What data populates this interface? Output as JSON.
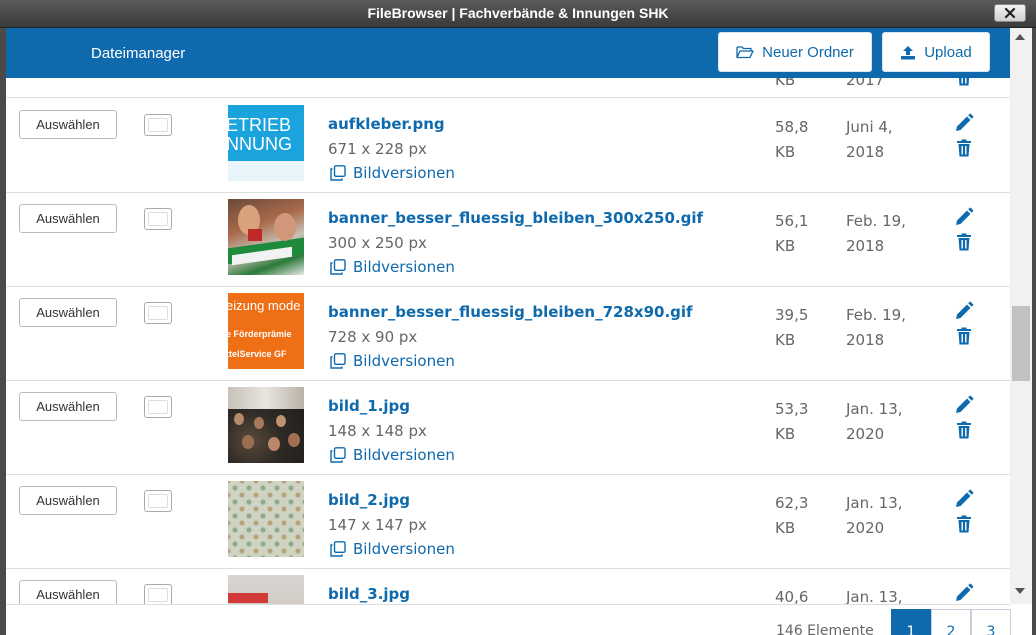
{
  "window": {
    "title": "FileBrowser | Fachverbände & Innungen SHK"
  },
  "header": {
    "title": "Dateimanager",
    "new_folder_label": "Neuer Ordner",
    "upload_label": "Upload"
  },
  "partial_row": {
    "size_unit": "KB",
    "date_year": "2017"
  },
  "labels": {
    "select": "Auswählen",
    "versions": "Bildversionen"
  },
  "files": [
    {
      "name": "aufkleber.png",
      "dims": "671 x 228 px",
      "size_num": "58,8",
      "size_unit": "KB",
      "date_md": "Juni 4,",
      "date_y": "2018"
    },
    {
      "name": "banner_besser_fluessig_bleiben_300x250.gif",
      "dims": "300 x 250 px",
      "size_num": "56,1",
      "size_unit": "KB",
      "date_md": "Feb. 19,",
      "date_y": "2018"
    },
    {
      "name": "banner_besser_fluessig_bleiben_728x90.gif",
      "dims": "728 x 90 px",
      "size_num": "39,5",
      "size_unit": "KB",
      "date_md": "Feb. 19,",
      "date_y": "2018"
    },
    {
      "name": "bild_1.jpg",
      "dims": "148 x 148 px",
      "size_num": "53,3",
      "size_unit": "KB",
      "date_md": "Jan. 13,",
      "date_y": "2020"
    },
    {
      "name": "bild_2.jpg",
      "dims": "147 x 147 px",
      "size_num": "62,3",
      "size_unit": "KB",
      "date_md": "Jan. 13,",
      "date_y": "2020"
    },
    {
      "name": "bild_3.jpg",
      "dims": "",
      "size_num": "40,6",
      "size_unit": "",
      "date_md": "Jan. 13,",
      "date_y": ""
    }
  ],
  "thumb_texts": {
    "aufkleber_line1": "ETRIEB",
    "aufkleber_line2": "NNUNG",
    "banner728_line1": "eizung mode",
    "banner728_line2": "e Förderprämie",
    "banner728_line3": "ttelService GF"
  },
  "footer": {
    "count": "146 Elemente",
    "pages": [
      "1",
      "2",
      "3"
    ],
    "active_page": "1"
  },
  "colors": {
    "accent": "#0e6aad",
    "muted_text": "#666666"
  },
  "icons": {
    "close": "close-icon",
    "folder": "folder-open-icon",
    "upload": "upload-icon",
    "versions": "copy-icon",
    "edit": "pencil-icon",
    "delete": "trash-icon"
  }
}
